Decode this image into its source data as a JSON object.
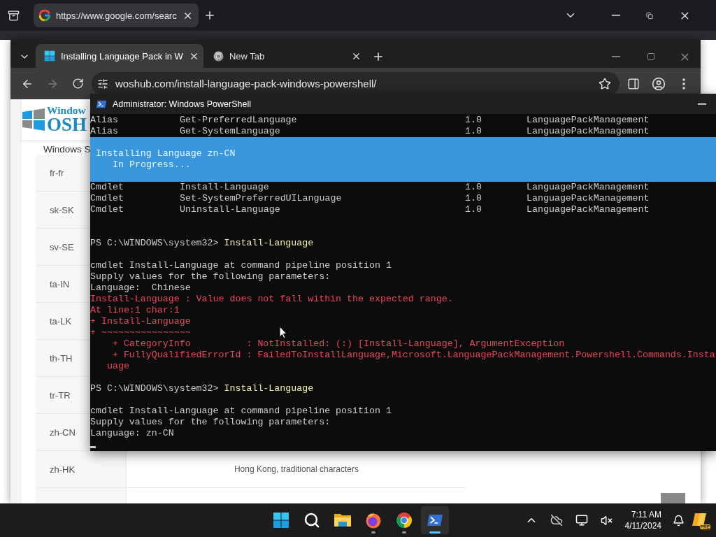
{
  "back_browser": {
    "tabs": [
      {
        "title": "https://www.google.com/searc",
        "selected": true
      }
    ]
  },
  "browser": {
    "tabs": [
      {
        "title": "Installing Language Pack in W",
        "selected": true
      },
      {
        "title": "New Tab",
        "selected": false
      }
    ],
    "address": "woshub.com/install-language-pack-windows-powershell/",
    "page": {
      "logo": {
        "line_1": "Window",
        "line_2": "OSH"
      },
      "heading": "Windows S",
      "rows": [
        {
          "code": "fr-fr",
          "description": ""
        },
        {
          "code": "sk-SK",
          "description": ""
        },
        {
          "code": "sv-SE",
          "description": ""
        },
        {
          "code": "ta-IN",
          "description": ""
        },
        {
          "code": "ta-LK",
          "description": ""
        },
        {
          "code": "th-TH",
          "description": ""
        },
        {
          "code": "tr-TR",
          "description": ""
        },
        {
          "code": "zh-CN",
          "description": ""
        },
        {
          "code": "zh-HK",
          "description": "Hong Kong, traditional characters"
        }
      ]
    }
  },
  "powershell": {
    "title": "Administrator: Windows PowerShell",
    "lines_before": [
      {
        "kind": "cmd_row",
        "columns": [
          "Alias",
          "Get-PreferredLanguage",
          "1.0",
          "LanguagePackManagement"
        ]
      },
      {
        "kind": "cmd_row",
        "columns": [
          "Alias",
          "Get-SystemLanguage",
          "1.0",
          "LanguagePackManagement"
        ]
      }
    ],
    "progress": {
      "activity": "Installing Language zn-CN",
      "status": "In Progress..."
    },
    "lines": [
      {
        "kind": "cmd_row",
        "columns": [
          "Cmdlet",
          "Install-Language",
          "1.0",
          "LanguagePackManagement"
        ]
      },
      {
        "kind": "cmd_row",
        "columns": [
          "Cmdlet",
          "Set-SystemPreferredUILanguage",
          "1.0",
          "LanguagePackManagement"
        ]
      },
      {
        "kind": "cmd_row",
        "columns": [
          "Cmdlet",
          "Uninstall-Language",
          "1.0",
          "LanguagePackManagement"
        ]
      },
      {
        "kind": "blank"
      },
      {
        "kind": "blank"
      },
      {
        "kind": "prompt",
        "prompt": "PS C:\\WINDOWS\\system32>",
        "command": "Install-Language"
      },
      {
        "kind": "blank"
      },
      {
        "kind": "text",
        "text": "cmdlet Install-Language at command pipeline position 1"
      },
      {
        "kind": "text",
        "text": "Supply values for the following parameters:"
      },
      {
        "kind": "text",
        "text": "Language:  Chinese"
      },
      {
        "kind": "error",
        "text": "Install-Language : Value does not fall within the expected range."
      },
      {
        "kind": "error",
        "text": "At line:1 char:1"
      },
      {
        "kind": "error",
        "text": "+ Install-Language"
      },
      {
        "kind": "error",
        "text": "+ ~~~~~~~~~~~~~~~~"
      },
      {
        "kind": "error",
        "text": "    + CategoryInfo          : NotInstalled: (:) [Install-Language], ArgumentException"
      },
      {
        "kind": "error",
        "text": "    + FullyQualifiedErrorId : FailedToInstallLanguage,Microsoft.LanguagePackManagement.Powershell.Commands.Insta"
      },
      {
        "kind": "error",
        "text": "   uage"
      },
      {
        "kind": "blank"
      },
      {
        "kind": "prompt",
        "prompt": "PS C:\\WINDOWS\\system32>",
        "command": "Install-Language"
      },
      {
        "kind": "blank"
      },
      {
        "kind": "text",
        "text": "cmdlet Install-Language at command pipeline position 1"
      },
      {
        "kind": "text",
        "text": "Supply values for the following parameters:"
      },
      {
        "kind": "text",
        "text": "Language: zn-CN"
      }
    ]
  },
  "taskbar": {
    "apps": [
      {
        "kind": "start",
        "running": false,
        "selected": false
      },
      {
        "kind": "search",
        "running": false,
        "selected": false
      },
      {
        "kind": "explorer",
        "running": false,
        "selected": false
      },
      {
        "kind": "firefox",
        "running": true,
        "selected": false
      },
      {
        "kind": "chrome",
        "running": true,
        "selected": false
      },
      {
        "kind": "powershell",
        "running": true,
        "selected": true
      }
    ],
    "time": "7:11 AM",
    "date": "4/11/2024",
    "copilot_badge": "PRE"
  }
}
